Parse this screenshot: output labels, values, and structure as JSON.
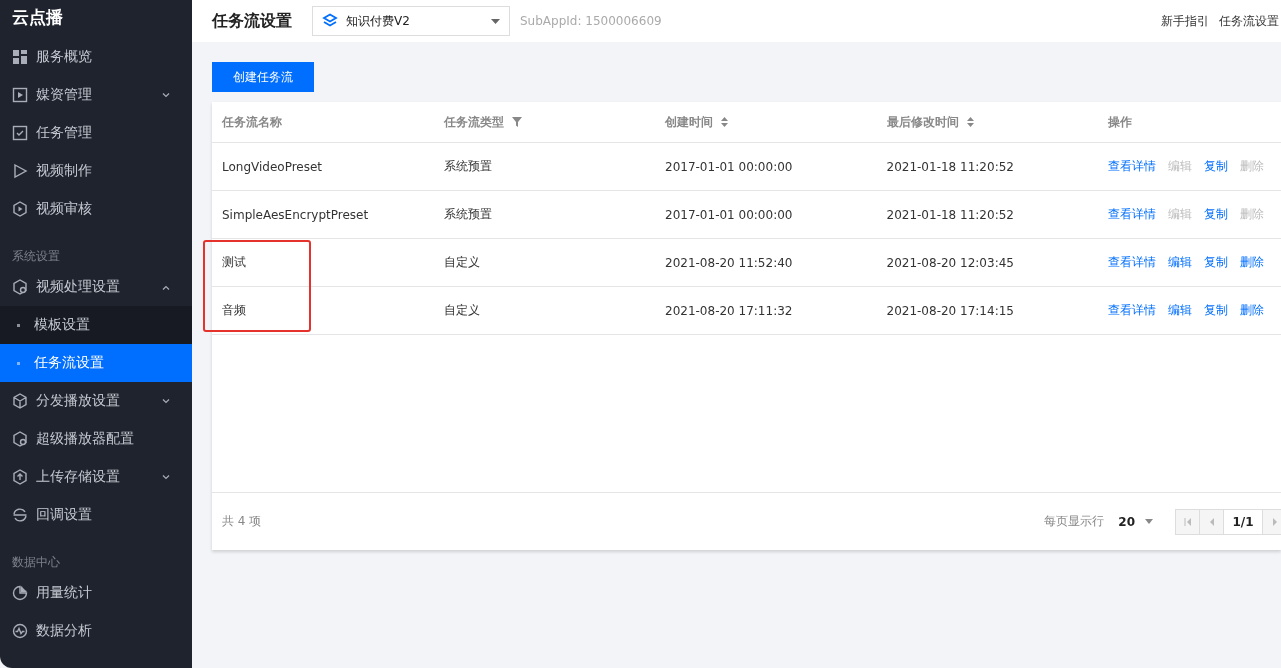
{
  "sidebar": {
    "title": "云点播",
    "groups": [
      {
        "items": [
          {
            "label": "服务概览",
            "expandable": false
          },
          {
            "label": "媒资管理",
            "expandable": true,
            "expanded": false
          },
          {
            "label": "任务管理",
            "expandable": false
          },
          {
            "label": "视频制作",
            "expandable": false
          },
          {
            "label": "视频审核",
            "expandable": false
          }
        ]
      },
      {
        "label": "系统设置",
        "items": [
          {
            "label": "视频处理设置",
            "expandable": true,
            "expanded": true,
            "children": [
              {
                "label": "模板设置",
                "selected": false
              },
              {
                "label": "任务流设置",
                "selected": true
              }
            ]
          },
          {
            "label": "分发播放设置",
            "expandable": true,
            "expanded": false
          },
          {
            "label": "超级播放器配置",
            "expandable": false
          },
          {
            "label": "上传存储设置",
            "expandable": true,
            "expanded": false
          },
          {
            "label": "回调设置",
            "expandable": false
          }
        ]
      },
      {
        "label": "数据中心",
        "items": [
          {
            "label": "用量统计",
            "expandable": false
          },
          {
            "label": "数据分析",
            "expandable": false
          }
        ]
      }
    ]
  },
  "header": {
    "title": "任务流设置",
    "app_select": {
      "value": "知识付费V2"
    },
    "sub_app_id": "SubAppId: 1500006609",
    "links": [
      "新手指引",
      "任务流设置"
    ]
  },
  "create_button": "创建任务流",
  "table": {
    "columns": [
      "任务流名称",
      "任务流类型",
      "创建时间",
      "最后修改时间",
      "操作"
    ],
    "rows": [
      {
        "name": "LongVideoPreset",
        "type": "系统预置",
        "created": "2017-01-01 00:00:00",
        "modified": "2021-01-18 11:20:52",
        "highlighted": false,
        "actions": [
          {
            "label": "查看详情",
            "disabled": false
          },
          {
            "label": "编辑",
            "disabled": true
          },
          {
            "label": "复制",
            "disabled": false
          },
          {
            "label": "删除",
            "disabled": true
          }
        ]
      },
      {
        "name": "SimpleAesEncryptPreset",
        "type": "系统预置",
        "created": "2017-01-01 00:00:00",
        "modified": "2021-01-18 11:20:52",
        "highlighted": false,
        "actions": [
          {
            "label": "查看详情",
            "disabled": false
          },
          {
            "label": "编辑",
            "disabled": true
          },
          {
            "label": "复制",
            "disabled": false
          },
          {
            "label": "删除",
            "disabled": true
          }
        ]
      },
      {
        "name": "测试",
        "type": "自定义",
        "created": "2021-08-20 11:52:40",
        "modified": "2021-08-20 12:03:45",
        "highlighted": true,
        "actions": [
          {
            "label": "查看详情",
            "disabled": false
          },
          {
            "label": "编辑",
            "disabled": false
          },
          {
            "label": "复制",
            "disabled": false
          },
          {
            "label": "删除",
            "disabled": false
          }
        ]
      },
      {
        "name": "音频",
        "type": "自定义",
        "created": "2021-08-20 17:11:32",
        "modified": "2021-08-20 17:14:15",
        "highlighted": true,
        "actions": [
          {
            "label": "查看详情",
            "disabled": false
          },
          {
            "label": "编辑",
            "disabled": false
          },
          {
            "label": "复制",
            "disabled": false
          },
          {
            "label": "删除",
            "disabled": false
          }
        ]
      }
    ],
    "footer": {
      "total": "共 4 项",
      "page_size_label": "每页显示行",
      "page_size": "20",
      "page": "1/1"
    }
  }
}
